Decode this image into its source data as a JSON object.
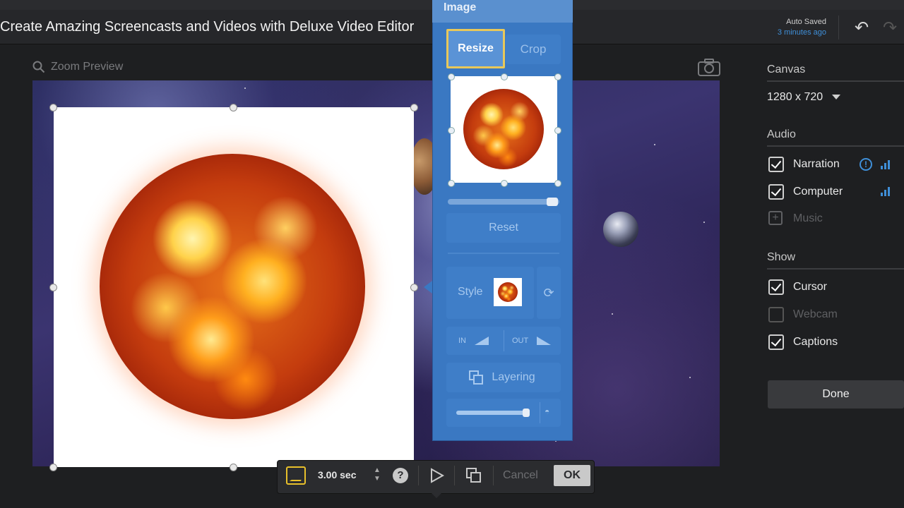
{
  "header": {
    "title": "Create Amazing Screencasts and Videos with Deluxe Video Editor",
    "autosave_label": "Auto Saved",
    "autosave_time": "3 minutes ago"
  },
  "preview": {
    "zoom_label": "Zoom Preview"
  },
  "image_panel": {
    "title": "Image",
    "tabs": [
      "Resize",
      "Crop"
    ],
    "active_tab": "Resize",
    "reset_label": "Reset",
    "style_label": "Style",
    "in_label": "IN",
    "out_label": "OUT",
    "layering_label": "Layering"
  },
  "bottom_toolbar": {
    "duration": "3.00 sec",
    "help_glyph": "?",
    "cancel_label": "Cancel",
    "ok_label": "OK"
  },
  "sidebar": {
    "canvas": {
      "title": "Canvas",
      "size": "1280 x 720"
    },
    "audio": {
      "title": "Audio",
      "items": [
        {
          "label": "Narration",
          "checked": true
        },
        {
          "label": "Computer",
          "checked": true
        },
        {
          "label": "Music",
          "checked": false
        }
      ]
    },
    "show": {
      "title": "Show",
      "items": [
        {
          "label": "Cursor",
          "checked": true
        },
        {
          "label": "Webcam",
          "checked": false
        },
        {
          "label": "Captions",
          "checked": true
        }
      ]
    },
    "done_label": "Done"
  },
  "colors": {
    "accent_blue": "#3a78c2",
    "highlight_yellow": "#e8c85a",
    "link_blue": "#3f8fd8"
  }
}
